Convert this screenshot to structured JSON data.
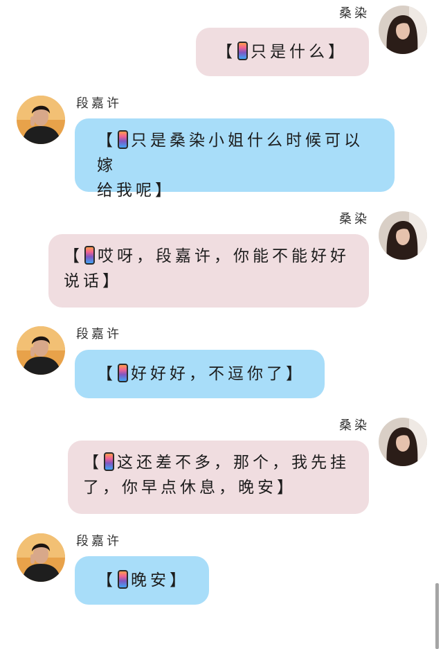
{
  "chat": {
    "me_name": "桑染",
    "him_name": "段嘉许",
    "bracket_open": "【",
    "bracket_close": "】",
    "phone_icon": "phone-icon",
    "colors": {
      "me_bubble": "#f0dde0",
      "him_bubble": "#a8ddf9"
    },
    "messages": [
      {
        "sender": "me",
        "text": "只是什么"
      },
      {
        "sender": "him",
        "line1": "只是桑染小姐什么时候可以嫁",
        "line2": "给我呢"
      },
      {
        "sender": "me",
        "line1": "哎呀，段嘉许，你能不能好好",
        "line2": "说话"
      },
      {
        "sender": "him",
        "text": "好好好，不逗你了"
      },
      {
        "sender": "me",
        "line1": "这还差不多，那个，我先挂",
        "line2": "了，你早点休息，晚安"
      },
      {
        "sender": "him",
        "text": "晚安"
      }
    ]
  }
}
